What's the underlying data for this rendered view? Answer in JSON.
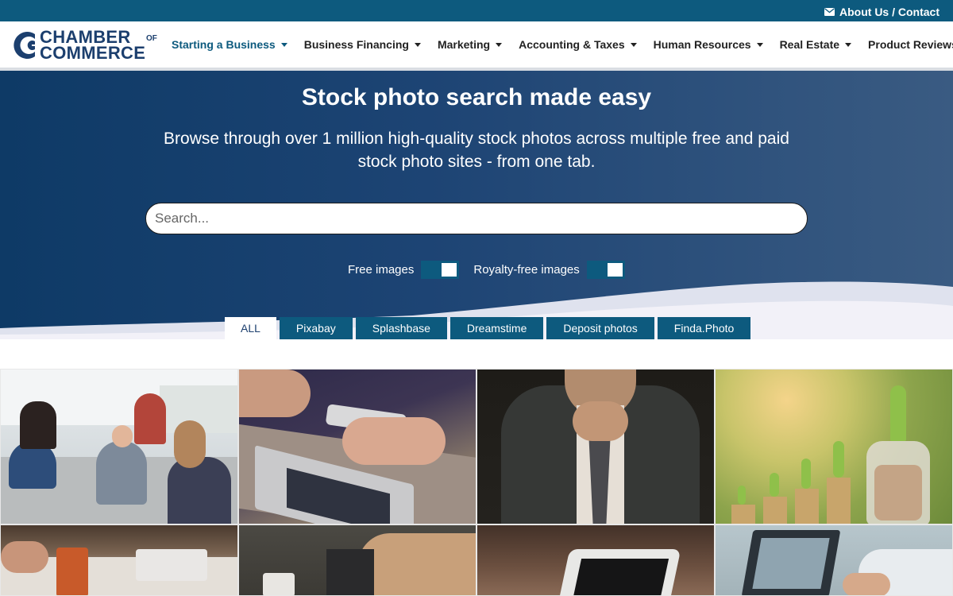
{
  "topbar": {
    "link_label": "About Us / Contact",
    "icon": "envelope-icon"
  },
  "logo": {
    "line1": "CHAMBER",
    "small": "OF",
    "line2": "COMMERCE"
  },
  "nav": {
    "items": [
      {
        "label": "Starting a Business",
        "active": true
      },
      {
        "label": "Business Financing",
        "active": false
      },
      {
        "label": "Marketing",
        "active": false
      },
      {
        "label": "Accounting & Taxes",
        "active": false
      },
      {
        "label": "Human Resources",
        "active": false
      },
      {
        "label": "Real Estate",
        "active": false
      },
      {
        "label": "Product Reviews",
        "active": false
      }
    ]
  },
  "hero": {
    "title": "Stock photo search made easy",
    "subtitle": "Browse through over 1 million high-quality stock photos across multiple free and paid stock photo sites - from one tab.",
    "search_placeholder": "Search...",
    "search_value": "",
    "toggles": [
      {
        "label": "Free images",
        "on": true
      },
      {
        "label": "Royalty-free images",
        "on": true
      }
    ]
  },
  "tabs": [
    {
      "label": "ALL",
      "active": true
    },
    {
      "label": "Pixabay",
      "active": false
    },
    {
      "label": "Splashbase",
      "active": false
    },
    {
      "label": "Dreamstime",
      "active": false
    },
    {
      "label": "Deposit photos",
      "active": false
    },
    {
      "label": "Finda.Photo",
      "active": false
    }
  ],
  "colors": {
    "brand": "#0d5a7e",
    "logo": "#1c3f6e",
    "hero_start": "#0e3a66",
    "hero_end": "#3a5b82"
  }
}
